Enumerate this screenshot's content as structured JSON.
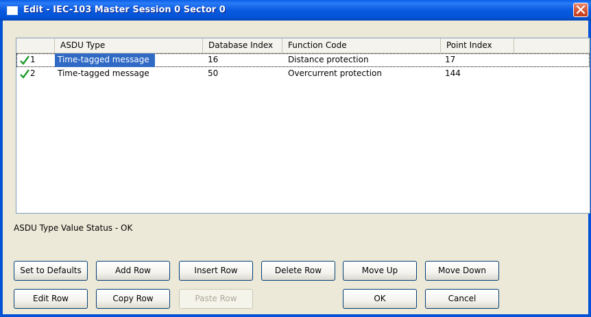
{
  "window": {
    "title": "Edit - IEC-103 Master Session 0 Sector 0"
  },
  "table": {
    "columns": [
      "",
      "ASDU Type",
      "Database Index",
      "Function Code",
      "Point Index",
      ""
    ],
    "rows": [
      {
        "num": "1",
        "asdu_type": "Time-tagged message",
        "database_index": "16",
        "function_code": "Distance protection",
        "point_index": "17",
        "status": "ok-check-icon"
      },
      {
        "num": "2",
        "asdu_type": "Time-tagged message",
        "database_index": "50",
        "function_code": "Overcurrent protection",
        "point_index": "144",
        "status": "ok-check-icon"
      }
    ]
  },
  "status_text": "ASDU Type Value Status - OK",
  "buttons": {
    "set_defaults": "Set to Defaults",
    "add_row": "Add Row",
    "insert_row": "Insert Row",
    "delete_row": "Delete Row",
    "move_up": "Move Up",
    "move_down": "Move Down",
    "edit_row": "Edit Row",
    "copy_row": "Copy Row",
    "paste_row": "Paste Row",
    "ok": "OK",
    "cancel": "Cancel"
  },
  "colors": {
    "titlebar": "#0453d6",
    "selection": "#316ac5",
    "check": "#1f9a2a",
    "dialog_bg": "#ece9d8"
  }
}
